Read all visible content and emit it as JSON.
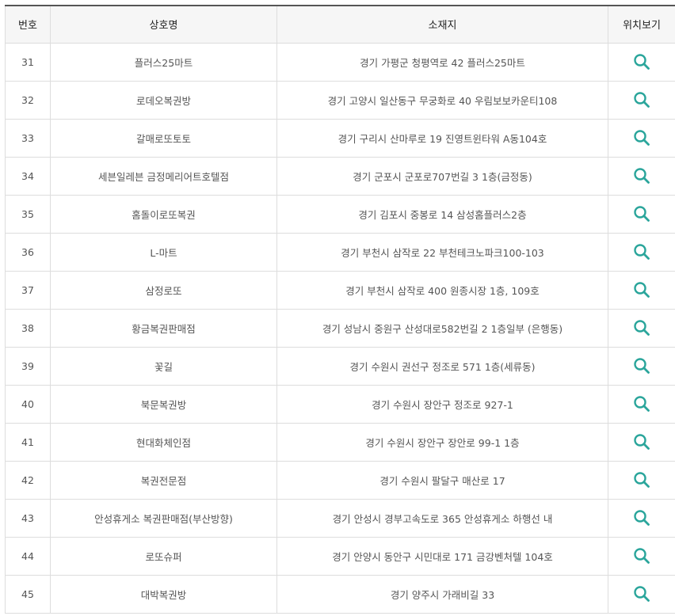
{
  "table": {
    "headers": {
      "number": "번호",
      "name": "상호명",
      "address": "소재지",
      "location": "위치보기"
    },
    "icon": "search-icon",
    "accent_color": "#2aa59b",
    "rows": [
      {
        "num": "31",
        "name": "플러스25마트",
        "address": "경기 가평군 청평역로 42 플러스25마트"
      },
      {
        "num": "32",
        "name": "로데오복권방",
        "address": "경기 고양시 일산동구 무궁화로 40 우림보보카운티108"
      },
      {
        "num": "33",
        "name": "갈매로또토토",
        "address": "경기 구리시 산마루로 19 진영트윈타워 A동104호"
      },
      {
        "num": "34",
        "name": "세븐일레븐 금정메리어트호텔점",
        "address": "경기 군포시 군포로707번길 3 1층(금정동)"
      },
      {
        "num": "35",
        "name": "홈돌이로또복권",
        "address": "경기 김포시 중봉로 14 삼성홈플러스2층"
      },
      {
        "num": "36",
        "name": "L-마트",
        "address": "경기 부천시 삼작로 22 부천테크노파크100-103"
      },
      {
        "num": "37",
        "name": "삼정로또",
        "address": "경기 부천시 삼작로 400 원종시장 1층, 109호"
      },
      {
        "num": "38",
        "name": "황금복권판매점",
        "address": "경기 성남시 중원구 산성대로582번길 2 1층일부 (은행동)"
      },
      {
        "num": "39",
        "name": "꽃길",
        "address": "경기 수원시 권선구 정조로 571 1층(세류동)"
      },
      {
        "num": "40",
        "name": "북문복권방",
        "address": "경기 수원시 장안구 정조로 927-1"
      },
      {
        "num": "41",
        "name": "현대화체인점",
        "address": "경기 수원시 장안구 장안로 99-1 1층"
      },
      {
        "num": "42",
        "name": "복권전문점",
        "address": "경기 수원시 팔달구 매산로 17"
      },
      {
        "num": "43",
        "name": "안성휴게소 복권판매점(부산방향)",
        "address": "경기 안성시 경부고속도로 365 안성휴게소 하행선 내"
      },
      {
        "num": "44",
        "name": "로또슈퍼",
        "address": "경기 안양시 동안구 시민대로 171 금강벤처텔 104호"
      },
      {
        "num": "45",
        "name": "대박복권방",
        "address": "경기 양주시 가래비길 33"
      }
    ]
  }
}
